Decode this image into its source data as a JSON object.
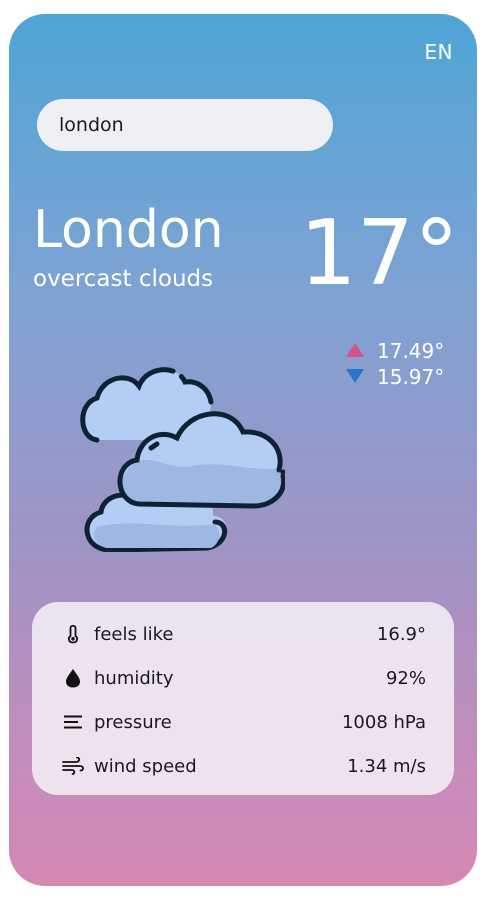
{
  "header": {
    "language": "EN"
  },
  "search": {
    "value": "london",
    "placeholder": ""
  },
  "current": {
    "city": "London",
    "description": "overcast clouds",
    "temperature": "17°",
    "temp_max": "17.49°",
    "temp_min": "15.97°",
    "icon": "overcast-clouds-icon"
  },
  "details": {
    "items": [
      {
        "icon": "thermometer-icon",
        "label": "feels like",
        "value": "16.9°"
      },
      {
        "icon": "water-drop-icon",
        "label": "humidity",
        "value": "92%"
      },
      {
        "icon": "pressure-lines-icon",
        "label": "pressure",
        "value": "1008 hPa"
      },
      {
        "icon": "wind-icon",
        "label": "wind speed",
        "value": "1.34 m/s"
      }
    ]
  },
  "colors": {
    "gradient_top": "#4fa4d6",
    "gradient_bottom": "#d488b2",
    "max_arrow": "#d6528a",
    "min_arrow": "#2f73c8",
    "cloud_fill": "#b3cdf5",
    "cloud_outline": "#0f2233"
  }
}
